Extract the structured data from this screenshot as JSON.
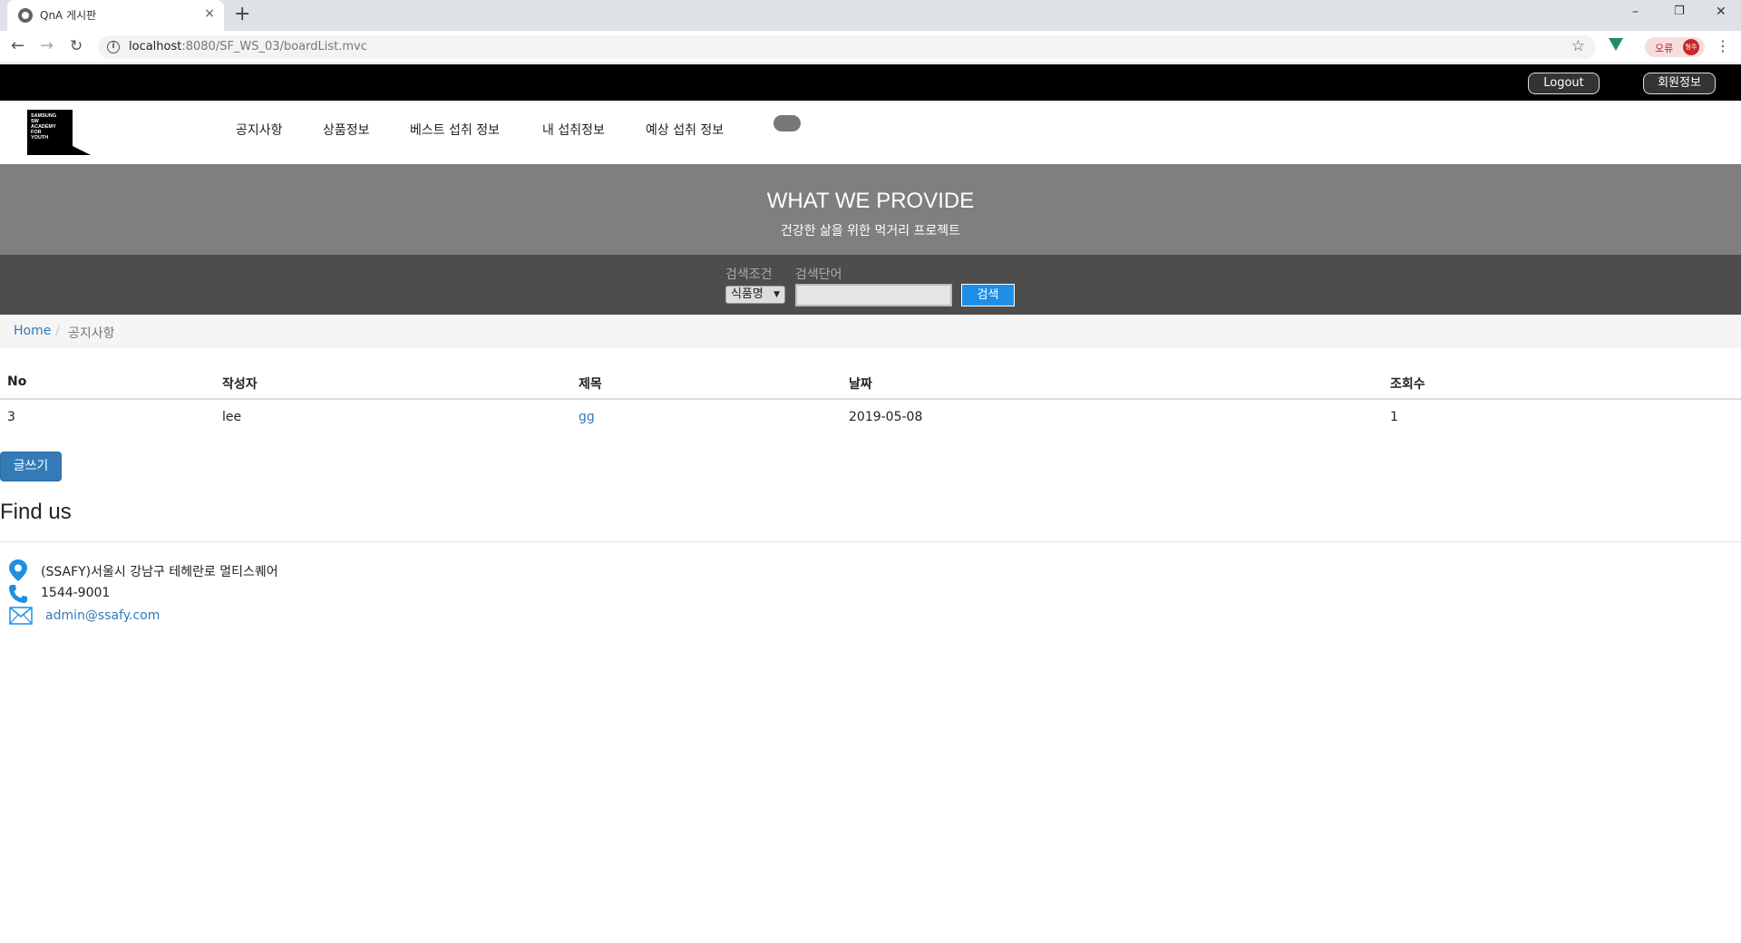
{
  "browser": {
    "tab_title": "QnA 게시판",
    "tab_close": "×",
    "new_tab": "+",
    "url_host": "localhost",
    "url_path": ":8080/SF_WS_03/boardList.mvc",
    "error_label": "오류",
    "profile_initials": "형주",
    "window_controls": {
      "minimize": "–",
      "restore": "❐",
      "close": "✕"
    },
    "icons": [
      "back-arrow-icon",
      "forward-arrow-icon",
      "reload-icon",
      "info-icon",
      "star-icon",
      "vue-devtools-icon",
      "menu-dots-icon"
    ]
  },
  "header": {
    "logout_label": "Logout",
    "member_info_label": "회원정보",
    "logo_text": [
      "SAMSUNG",
      "SW",
      "ACADEMY",
      "FOR",
      "YOUTH"
    ],
    "nav": [
      "공지사항",
      "상품정보",
      "베스트 섭취 정보",
      "내 섭취정보",
      "예상 섭취 정보"
    ]
  },
  "hero": {
    "title": "WHAT WE PROVIDE",
    "subtitle": "건강한 삶을 위한 먹거리 프로젝트"
  },
  "search": {
    "condition_label": "검색조건",
    "keyword_label": "검색단어",
    "select_value": "식품명",
    "keyword_value": "",
    "button_label": "검색"
  },
  "breadcrumb": {
    "home": "Home",
    "separator": "/",
    "current": "공지사항"
  },
  "table": {
    "headers": [
      "No",
      "작성자",
      "제목",
      "날짜",
      "조회수"
    ],
    "rows": [
      {
        "no": "3",
        "writer": "lee",
        "title": "gg",
        "date": "2019-05-08",
        "views": "1"
      }
    ]
  },
  "write_button_label": "글쓰기",
  "footer": {
    "title": "Find us",
    "address": "(SSAFY)서울시 강남구 테헤란로 멀티스퀘어",
    "phone": "1544-9001",
    "email": "admin@ssafy.com"
  },
  "colors": {
    "topbar": "#000000",
    "hero_bg": "#7f7f7f",
    "search_bg": "#4d4d4d",
    "search_button": "#1e8fe8",
    "primary": "#337ab7",
    "footer_icon": "#1e90e0"
  }
}
